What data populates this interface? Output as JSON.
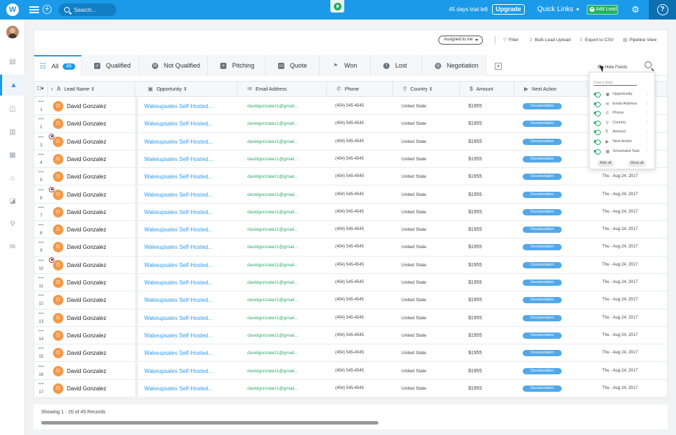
{
  "topbar": {
    "search_placeholder": "Search...",
    "trial": "45 days trial left",
    "upgrade": "Upgrade",
    "quick_links": "Quick Links",
    "add_lead": "Add Lead",
    "help": "?"
  },
  "toolbar": {
    "assigned": "Assigned to me",
    "filter": "Filter",
    "bulk_upload": "Bulk Lead Upload",
    "export": "Export to CSV",
    "pipeline": "Pipeline View"
  },
  "tabs": {
    "all_label": "All",
    "all_count": "45",
    "items": [
      {
        "label": "Qualified"
      },
      {
        "label": "Not Qualified"
      },
      {
        "label": "Pitching"
      },
      {
        "label": "Quote"
      },
      {
        "label": "Won"
      },
      {
        "label": "Lost"
      },
      {
        "label": "Negotiation"
      }
    ],
    "hide_fields": "Hide Fields"
  },
  "columns": {
    "lead_name": "Lead Name",
    "opportunity": "Opportunity",
    "email": "Email Address",
    "phone": "Phone",
    "country": "Country",
    "amount": "Amount",
    "next_action": "Next Action"
  },
  "rows": [
    {
      "num": "1",
      "initial": "D",
      "name": "David Gonzalez",
      "opp": "Wakeupsales Self-Hosted...",
      "email": "davidgonzalez1@gmail...",
      "phone": "(454) 545-4545",
      "country": "United State",
      "amount": "$1955",
      "next": "Documentation",
      "date": "",
      "rec": false
    },
    {
      "num": "2",
      "initial": "D",
      "name": "David Gonzalez",
      "opp": "Wakeupsales Self-Hosted...",
      "email": "davidgonzalez1@gmail...",
      "phone": "(454) 545-4545",
      "country": "United State",
      "amount": "$1955",
      "next": "Documentation",
      "date": "",
      "rec": false
    },
    {
      "num": "3",
      "initial": "D",
      "name": "David Gonzalez",
      "opp": "Wakeupsales Self-Hosted...",
      "email": "davidgonzalez1@gmail...",
      "phone": "(454) 545-4545",
      "country": "United State",
      "amount": "$1955",
      "next": "Documentation",
      "date": "",
      "rec": true
    },
    {
      "num": "4",
      "initial": "D",
      "name": "David Gonzalez",
      "opp": "Wakeupsales Self-Hosted...",
      "email": "davidgonzalez1@gmail...",
      "phone": "(454) 545-4545",
      "country": "United State",
      "amount": "$1955",
      "next": "Documentation",
      "date": "",
      "rec": false
    },
    {
      "num": "5",
      "initial": "D",
      "name": "David Gonzalez",
      "opp": "Wakeupsales Self-Hosted...",
      "email": "davidgonzalez1@gmail...",
      "phone": "(454) 545-4545",
      "country": "United State",
      "amount": "$1955",
      "next": "Documentation",
      "date": "Thu - Aug 24, 2017",
      "rec": false
    },
    {
      "num": "6",
      "initial": "D",
      "name": "David Gonzalez",
      "opp": "Wakeupsales Self-Hosted...",
      "email": "davidgonzalez1@gmail...",
      "phone": "(454) 545-4545",
      "country": "United State",
      "amount": "$1955",
      "next": "Documentation",
      "date": "Thu - Aug 24, 2017",
      "rec": true
    },
    {
      "num": "7",
      "initial": "D",
      "name": "David Gonzalez",
      "opp": "Wakeupsales Self-Hosted...",
      "email": "davidgonzalez1@gmail...",
      "phone": "(454) 545-4545",
      "country": "United State",
      "amount": "$1955",
      "next": "Documentation",
      "date": "Thu - Aug 24, 2017",
      "rec": false
    },
    {
      "num": "8",
      "initial": "D",
      "name": "David Gonzalez",
      "opp": "Wakeupsales Self-Hosted...",
      "email": "davidgonzalez1@gmail...",
      "phone": "(454) 545-4545",
      "country": "United State",
      "amount": "$1955",
      "next": "Documentation",
      "date": "Thu - Aug 24, 2017",
      "rec": false
    },
    {
      "num": "9",
      "initial": "D",
      "name": "David Gonzalez",
      "opp": "Wakeupsales Self-Hosted...",
      "email": "davidgonzalez1@gmail...",
      "phone": "(454) 545-4545",
      "country": "United State",
      "amount": "$1955",
      "next": "Documentation",
      "date": "Thu - Aug 24, 2017",
      "rec": false
    },
    {
      "num": "10",
      "initial": "D",
      "name": "David Gonzalez",
      "opp": "Wakeupsales Self-Hosted...",
      "email": "davidgonzalez1@gmail...",
      "phone": "(454) 545-4545",
      "country": "United State",
      "amount": "$1955",
      "next": "Documentation",
      "date": "Thu - Aug 24, 2017",
      "rec": true
    },
    {
      "num": "11",
      "initial": "D",
      "name": "David Gonzalez",
      "opp": "Wakeupsales Self-Hosted...",
      "email": "davidgonzalez1@gmail...",
      "phone": "(454) 545-4545",
      "country": "United State",
      "amount": "$1955",
      "next": "Documentation",
      "date": "Thu - Aug 24, 2017",
      "rec": false
    },
    {
      "num": "12",
      "initial": "D",
      "name": "David Gonzalez",
      "opp": "Wakeupsales Self-Hosted...",
      "email": "davidgonzalez1@gmail...",
      "phone": "(454) 545-4545",
      "country": "United State",
      "amount": "$1955",
      "next": "Documentation",
      "date": "Thu - Aug 24, 2017",
      "rec": false
    },
    {
      "num": "13",
      "initial": "D",
      "name": "David Gonzalez",
      "opp": "Wakeupsales Self-Hosted...",
      "email": "davidgonzalez1@gmail...",
      "phone": "(454) 545-4545",
      "country": "United State",
      "amount": "$1955",
      "next": "Documentation",
      "date": "Thu - Aug 24, 2017",
      "rec": false
    },
    {
      "num": "14",
      "initial": "D",
      "name": "David Gonzalez",
      "opp": "Wakeupsales Self-Hosted...",
      "email": "davidgonzalez1@gmail...",
      "phone": "(454) 545-4545",
      "country": "United State",
      "amount": "$1955",
      "next": "Documentation",
      "date": "Thu - Aug 24, 2017",
      "rec": false
    },
    {
      "num": "15",
      "initial": "D",
      "name": "David Gonzalez",
      "opp": "Wakeupsales Self-Hosted...",
      "email": "davidgonzalez1@gmail...",
      "phone": "(454) 545-4545",
      "country": "United State",
      "amount": "$1955",
      "next": "Documentation",
      "date": "Thu - Aug 24, 2017",
      "rec": false
    },
    {
      "num": "16",
      "initial": "D",
      "name": "David Gonzalez",
      "opp": "Wakeupsales Self-Hosted...",
      "email": "davidgonzalez1@gmail...",
      "phone": "(454) 545-4545",
      "country": "United State",
      "amount": "$1955",
      "next": "Documentation",
      "date": "Thu - Aug 24, 2017",
      "rec": false
    },
    {
      "num": "17",
      "initial": "D",
      "name": "David Gonzalez",
      "opp": "Wakeupsales Self-Hosted...",
      "email": "davidgonzalez1@gmail...",
      "phone": "(454) 545-4545",
      "country": "United State",
      "amount": "$1955",
      "next": "Documentation",
      "date": "Thu - Aug 24, 2017",
      "rec": false
    }
  ],
  "popup": {
    "find_placeholder": "Find a field",
    "fields": [
      {
        "label": "Opportunity",
        "icon": "briefcase-icon"
      },
      {
        "label": "Email Address",
        "icon": "envelope-icon"
      },
      {
        "label": "Phone",
        "icon": "phone-icon"
      },
      {
        "label": "Country",
        "icon": "pin-icon"
      },
      {
        "label": "Amount",
        "icon": "dollar-icon"
      },
      {
        "label": "Next Action",
        "icon": "video-icon"
      },
      {
        "label": "Scheduled Task",
        "icon": "calendar-icon"
      }
    ],
    "hide_all": "Hide all",
    "show_all": "Show all"
  },
  "footer": {
    "records": "Showing 1 - 20 of  45 Records"
  }
}
